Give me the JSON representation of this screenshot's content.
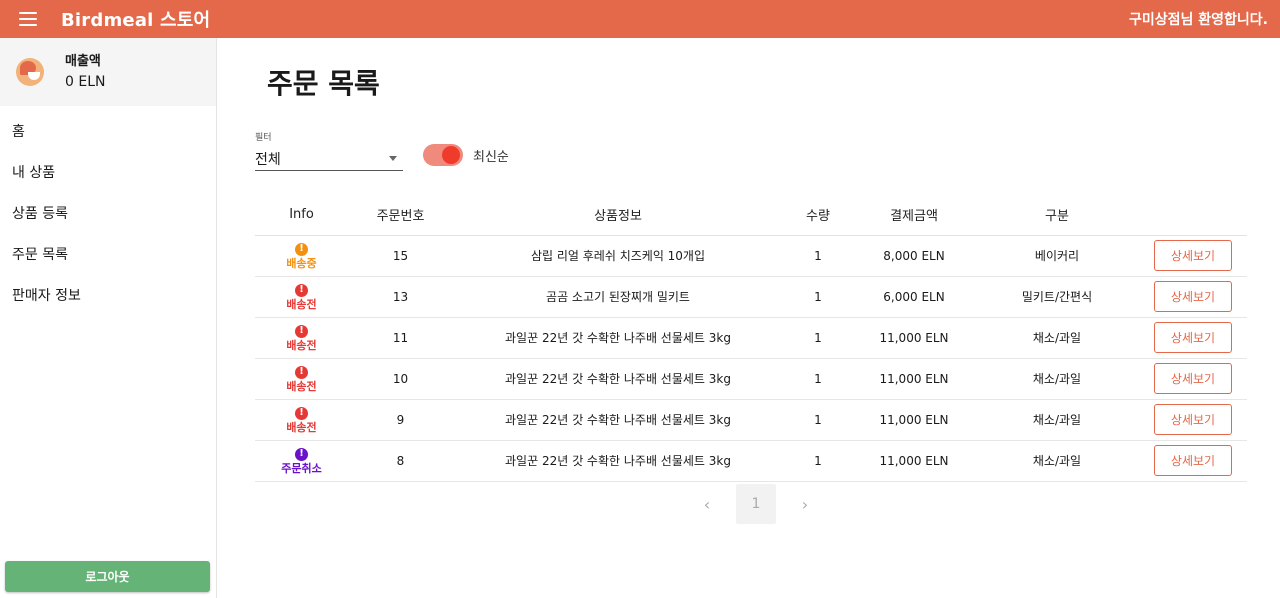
{
  "appbar": {
    "brand": "Birdmeal 스토어",
    "welcome": "구미상점님 환영합니다.",
    "color": "#e4694a"
  },
  "sidebar": {
    "sales_label": "매출액",
    "sales_value": "0 ELN",
    "items": [
      {
        "label": "홈"
      },
      {
        "label": "내 상품"
      },
      {
        "label": "상품 등록"
      },
      {
        "label": "주문 목록"
      },
      {
        "label": "판매자 정보"
      }
    ],
    "logout": "로그아웃"
  },
  "main": {
    "title": "주문 목록",
    "filter": {
      "label": "필터",
      "value": "전체"
    },
    "sort_toggle": {
      "label": "최신순",
      "on": true
    }
  },
  "table": {
    "headers": [
      "Info",
      "주문번호",
      "상품정보",
      "수량",
      "결제금액",
      "구분",
      ""
    ],
    "rows": [
      {
        "status": "배송중",
        "status_color": "#f29111",
        "id": "15",
        "product": "삼립 리얼 후레쉬 치즈케익 10개입",
        "qty": "1",
        "price": "8,000 ELN",
        "category": "베이커리",
        "action": "상세보기"
      },
      {
        "status": "배송전",
        "status_color": "#e53935",
        "id": "13",
        "product": "곰곰 소고기 된장찌개 밀키트",
        "qty": "1",
        "price": "6,000 ELN",
        "category": "밀키트/간편식",
        "action": "상세보기"
      },
      {
        "status": "배송전",
        "status_color": "#e53935",
        "id": "11",
        "product": "과일꾼 22년 갓 수확한 나주배 선물세트 3kg",
        "qty": "1",
        "price": "11,000 ELN",
        "category": "채소/과일",
        "action": "상세보기"
      },
      {
        "status": "배송전",
        "status_color": "#e53935",
        "id": "10",
        "product": "과일꾼 22년 갓 수확한 나주배 선물세트 3kg",
        "qty": "1",
        "price": "11,000 ELN",
        "category": "채소/과일",
        "action": "상세보기"
      },
      {
        "status": "배송전",
        "status_color": "#e53935",
        "id": "9",
        "product": "과일꾼 22년 갓 수확한 나주배 선물세트 3kg",
        "qty": "1",
        "price": "11,000 ELN",
        "category": "채소/과일",
        "action": "상세보기"
      },
      {
        "status": "주문취소",
        "status_color": "#6a11cb",
        "id": "8",
        "product": "과일꾼 22년 갓 수확한 나주배 선물세트 3kg",
        "qty": "1",
        "price": "11,000 ELN",
        "category": "채소/과일",
        "action": "상세보기"
      }
    ]
  },
  "pagination": {
    "current": "1"
  }
}
